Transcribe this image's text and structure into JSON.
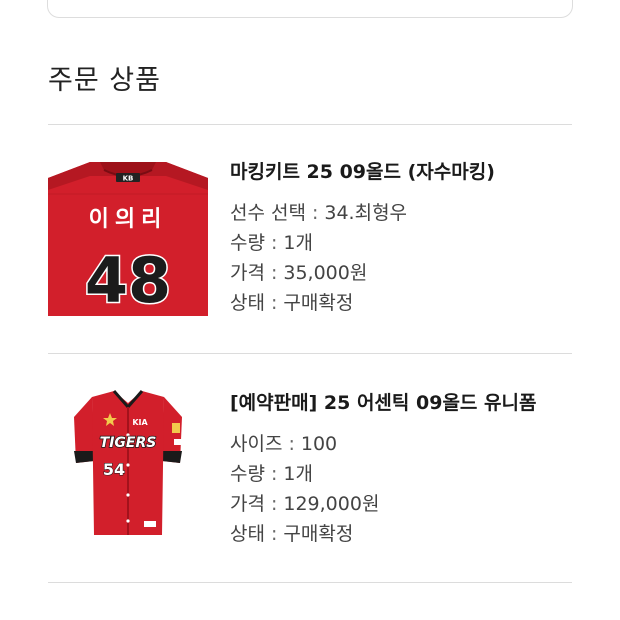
{
  "section": {
    "title": "주문 상품"
  },
  "orders": [
    {
      "name": "마킹키트 25 09올드 (자수마킹)",
      "image": {
        "kind": "marking-kit",
        "player_name": "이의리",
        "number": "48",
        "badge": "KB"
      },
      "details": [
        {
          "label": "선수 선택",
          "value": "34.최형우"
        },
        {
          "label": "수량",
          "value": "1개"
        },
        {
          "label": "가격",
          "value": "35,000원"
        },
        {
          "label": "상태",
          "value": "구매확정"
        }
      ]
    },
    {
      "name": "[예약판매] 25 어센틱 09올드 유니폼",
      "image": {
        "kind": "jersey",
        "wordmark": "TIGERS",
        "number": "54",
        "sponsor": "KIA"
      },
      "details": [
        {
          "label": "사이즈",
          "value": "100"
        },
        {
          "label": "수량",
          "value": "1개"
        },
        {
          "label": "가격",
          "value": "129,000원"
        },
        {
          "label": "상태",
          "value": "구매확정"
        }
      ]
    }
  ],
  "colors": {
    "jersey_red": "#d21f2b",
    "dark_red": "#a3121c",
    "divider": "#dcdcdc"
  }
}
